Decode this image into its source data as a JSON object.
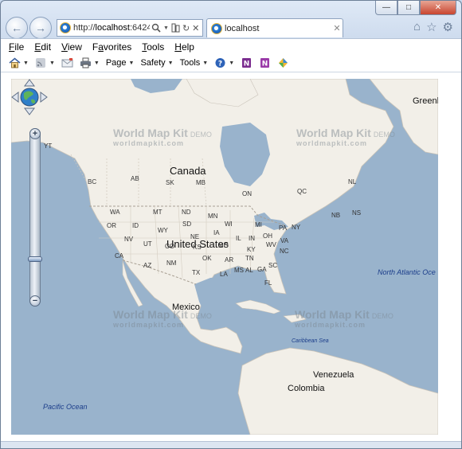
{
  "browser": {
    "address": {
      "prefix": "http://",
      "host": "localhost",
      "suffix": ":6424"
    },
    "tab_title": "localhost",
    "window_controls": {
      "minimize": "—",
      "maximize": "□",
      "close": "✕"
    }
  },
  "menubar": [
    "File",
    "Edit",
    "View",
    "Favorites",
    "Tools",
    "Help"
  ],
  "menubar_access_keys": [
    "F",
    "E",
    "V",
    "a",
    "T",
    "H"
  ],
  "commandbar": {
    "page": "Page",
    "safety": "Safety",
    "tools": "Tools"
  },
  "icons": {
    "back": "back-arrow-icon",
    "forward": "forward-arrow-icon",
    "search": "search-icon",
    "compat": "compatibility-icon",
    "refresh": "refresh-icon",
    "stop": "stop-icon",
    "home": "home-icon",
    "favorites": "star-icon",
    "settings": "gear-icon",
    "feeds": "rss-feed-icon",
    "mail": "mail-icon",
    "print": "printer-icon",
    "help": "help-icon",
    "onenote": "onenote-icon",
    "translate": "translate-icon"
  },
  "map": {
    "countries": {
      "canada": "Canada",
      "us": "United States",
      "mexico": "Mexico",
      "venezuela": "Venezuela",
      "colombia": "Colombia",
      "greenland": "Greenl"
    },
    "oceans": {
      "north_atlantic": "North Atlantic Oce",
      "pacific": "Pacific Ocean",
      "caribbean": "Caribbean Sea"
    },
    "provinces": [
      "YT",
      "BC",
      "AB",
      "SK",
      "MB",
      "ON",
      "QC",
      "NL",
      "NB",
      "NS"
    ],
    "states": [
      "WA",
      "MT",
      "ND",
      "MN",
      "OR",
      "ID",
      "SD",
      "WI",
      "MI",
      "WY",
      "NE",
      "IA",
      "IL",
      "IN",
      "OH",
      "PA",
      "NY",
      "NV",
      "UT",
      "CO",
      "KS",
      "MO",
      "KY",
      "WV",
      "VA",
      "CA",
      "AZ",
      "NM",
      "OK",
      "AR",
      "TN",
      "NC",
      "SC",
      "TX",
      "LA",
      "MS",
      "AL",
      "GA",
      "FL"
    ],
    "watermark": {
      "title": "World Map Kit",
      "tag": "DEMO",
      "url": "worldmapkit.com"
    },
    "zoom": {
      "plus": "+",
      "minus": "−",
      "level_fraction": 0.77
    }
  },
  "colors": {
    "water": "#99b3cc",
    "land": "#f2efe8",
    "border": "#b9b3a8",
    "accent": "#1c5fb3"
  }
}
